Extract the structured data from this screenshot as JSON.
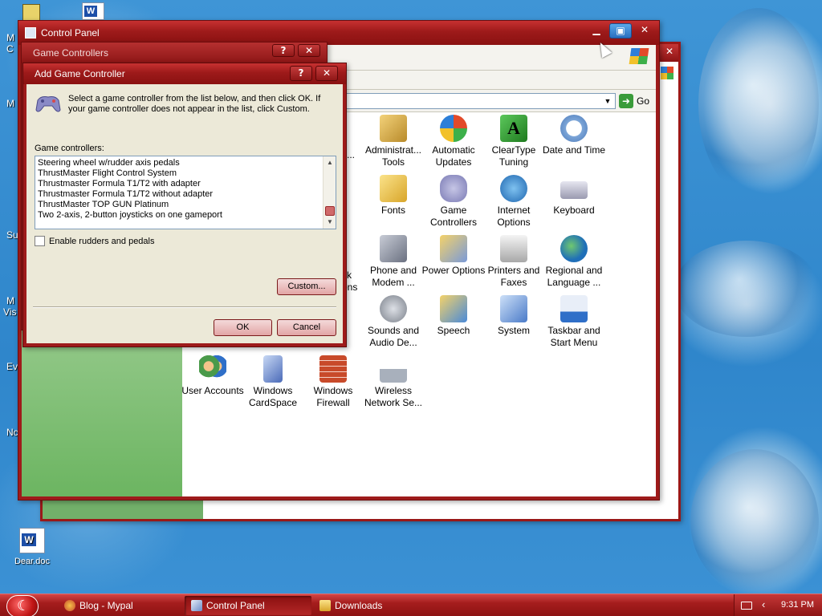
{
  "desktop": {
    "icons": [
      {
        "label": "Dear.doc",
        "icon": "word-document-icon"
      }
    ],
    "edge_labels": [
      "M",
      "C",
      "M",
      "Su",
      "M",
      "Vis",
      "Ev",
      "Nc"
    ]
  },
  "control_panel": {
    "title": "Control Panel",
    "address_go": "Go",
    "items": [
      {
        "label": "Administrat... Tools",
        "icon": "administrative-tools-icon",
        "color": "#c9a14a"
      },
      {
        "label": "Automatic Updates",
        "icon": "windows-update-icon",
        "color": "#2f7fd8"
      },
      {
        "label": "ClearType Tuning",
        "icon": "cleartype-icon",
        "color": "#3aa14a"
      },
      {
        "label": "Date and Time",
        "icon": "clock-icon",
        "color": "#7da6d8"
      },
      {
        "label": "Fonts",
        "icon": "fonts-folder-icon",
        "color": "#e8c44a"
      },
      {
        "label": "Game Controllers",
        "icon": "gamepad-icon",
        "color": "#9b9bc8"
      },
      {
        "label": "Internet Options",
        "icon": "internet-options-icon",
        "color": "#3d86c9"
      },
      {
        "label": "Keyboard",
        "icon": "keyboard-icon",
        "color": "#b8b8c8"
      },
      {
        "label": "Phone and Modem ...",
        "icon": "phone-modem-icon",
        "color": "#8f9aa8"
      },
      {
        "label": "Power Options",
        "icon": "power-options-icon",
        "color": "#d9b24a"
      },
      {
        "label": "Printers and Faxes",
        "icon": "printer-icon",
        "color": "#c8c8c8"
      },
      {
        "label": "Regional and Language ...",
        "icon": "globe-icon",
        "color": "#2f88c8"
      },
      {
        "label": "Sounds and Audio De...",
        "icon": "speaker-icon",
        "color": "#9aa0a8"
      },
      {
        "label": "Speech",
        "icon": "speech-icon",
        "color": "#e0b04a"
      },
      {
        "label": "System",
        "icon": "system-icon",
        "color": "#6a9ad8"
      },
      {
        "label": "Taskbar and Start Menu",
        "icon": "taskbar-icon",
        "color": "#2f6fc8"
      },
      {
        "label": "User Accounts",
        "icon": "user-accounts-icon",
        "color": "#4a9a4a"
      },
      {
        "label": "Windows CardSpace",
        "icon": "cardspace-icon",
        "color": "#6a8ac8"
      },
      {
        "label": "Windows Firewall",
        "icon": "firewall-icon",
        "color": "#c84a2a"
      },
      {
        "label": "Wireless Network Se...",
        "icon": "wireless-network-icon",
        "color": "#8a9ab0"
      }
    ]
  },
  "game_controllers": {
    "title": "Game Controllers"
  },
  "add_dialog": {
    "title": "Add Game Controller",
    "intro": "Select a game controller from the list below, and then click OK.  If your game controller does not appear in the list, click Custom.",
    "list_label": "Game controllers:",
    "list_items": [
      "Steering wheel w/rudder axis pedals",
      "ThrustMaster Flight Control System",
      "Thrustmaster Formula T1/T2 with adapter",
      "Thrustmaster Formula T1/T2 without adapter",
      "ThrustMaster TOP GUN Platinum",
      "Two 2-axis, 2-button joysticks on one gameport"
    ],
    "checkbox_label": "Enable rudders and pedals",
    "custom_button": "Custom...",
    "ok_button": "OK",
    "cancel_button": "Cancel",
    "help_glyph": "?",
    "close_glyph": "✕"
  },
  "taskbar": {
    "tasks": [
      {
        "label": "Blog - Mypal",
        "icon": "browser-icon",
        "active": false
      },
      {
        "label": "Control Panel",
        "icon": "control-panel-icon",
        "active": true
      },
      {
        "label": "Downloads",
        "icon": "folder-icon",
        "active": false
      }
    ],
    "clock": "9:31 PM"
  }
}
